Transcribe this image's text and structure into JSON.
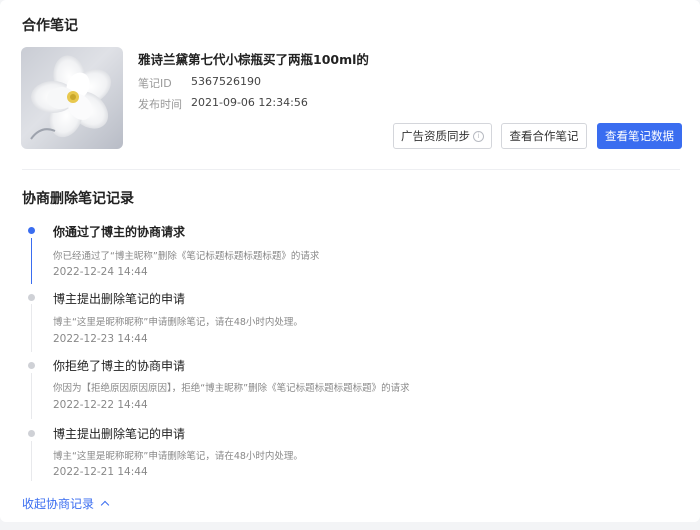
{
  "section1": {
    "title": "合作笔记"
  },
  "note": {
    "title": "雅诗兰黛第七代小棕瓶买了两瓶100ml的",
    "id_label": "笔记ID",
    "id_value": "5367526190",
    "time_label": "发布时间",
    "time_value": "2021-09-06 12:34:56"
  },
  "actions": {
    "ad_sync": "广告资质同步",
    "view_coop": "查看合作笔记",
    "view_data": "查看笔记数据"
  },
  "section2": {
    "title": "协商删除笔记记录"
  },
  "timeline": [
    {
      "title": "你通过了博主的协商请求",
      "desc": "你已经通过了“博主昵称”删除《笔记标题标题标题标题》的请求",
      "time": "2022-12-24 14:44",
      "active": true
    },
    {
      "title": "博主提出删除笔记的申请",
      "desc": "博主“这里是昵称昵称”申请删除笔记，请在48小时内处理。",
      "time": "2022-12-23 14:44",
      "active": false
    },
    {
      "title": "你拒绝了博主的协商申请",
      "desc": "你因为【拒绝原因原因原因】，拒绝“博主昵称”删除《笔记标题标题标题标题》的请求",
      "time": "2022-12-22 14:44",
      "active": false
    },
    {
      "title": "博主提出删除笔记的申请",
      "desc": "博主“这里是昵称昵称”申请删除笔记，请在48小时内处理。",
      "time": "2022-12-21 14:44",
      "active": false
    }
  ],
  "collapse": {
    "label": "收起协商记录"
  },
  "colors": {
    "accent": "#3a6df0"
  }
}
